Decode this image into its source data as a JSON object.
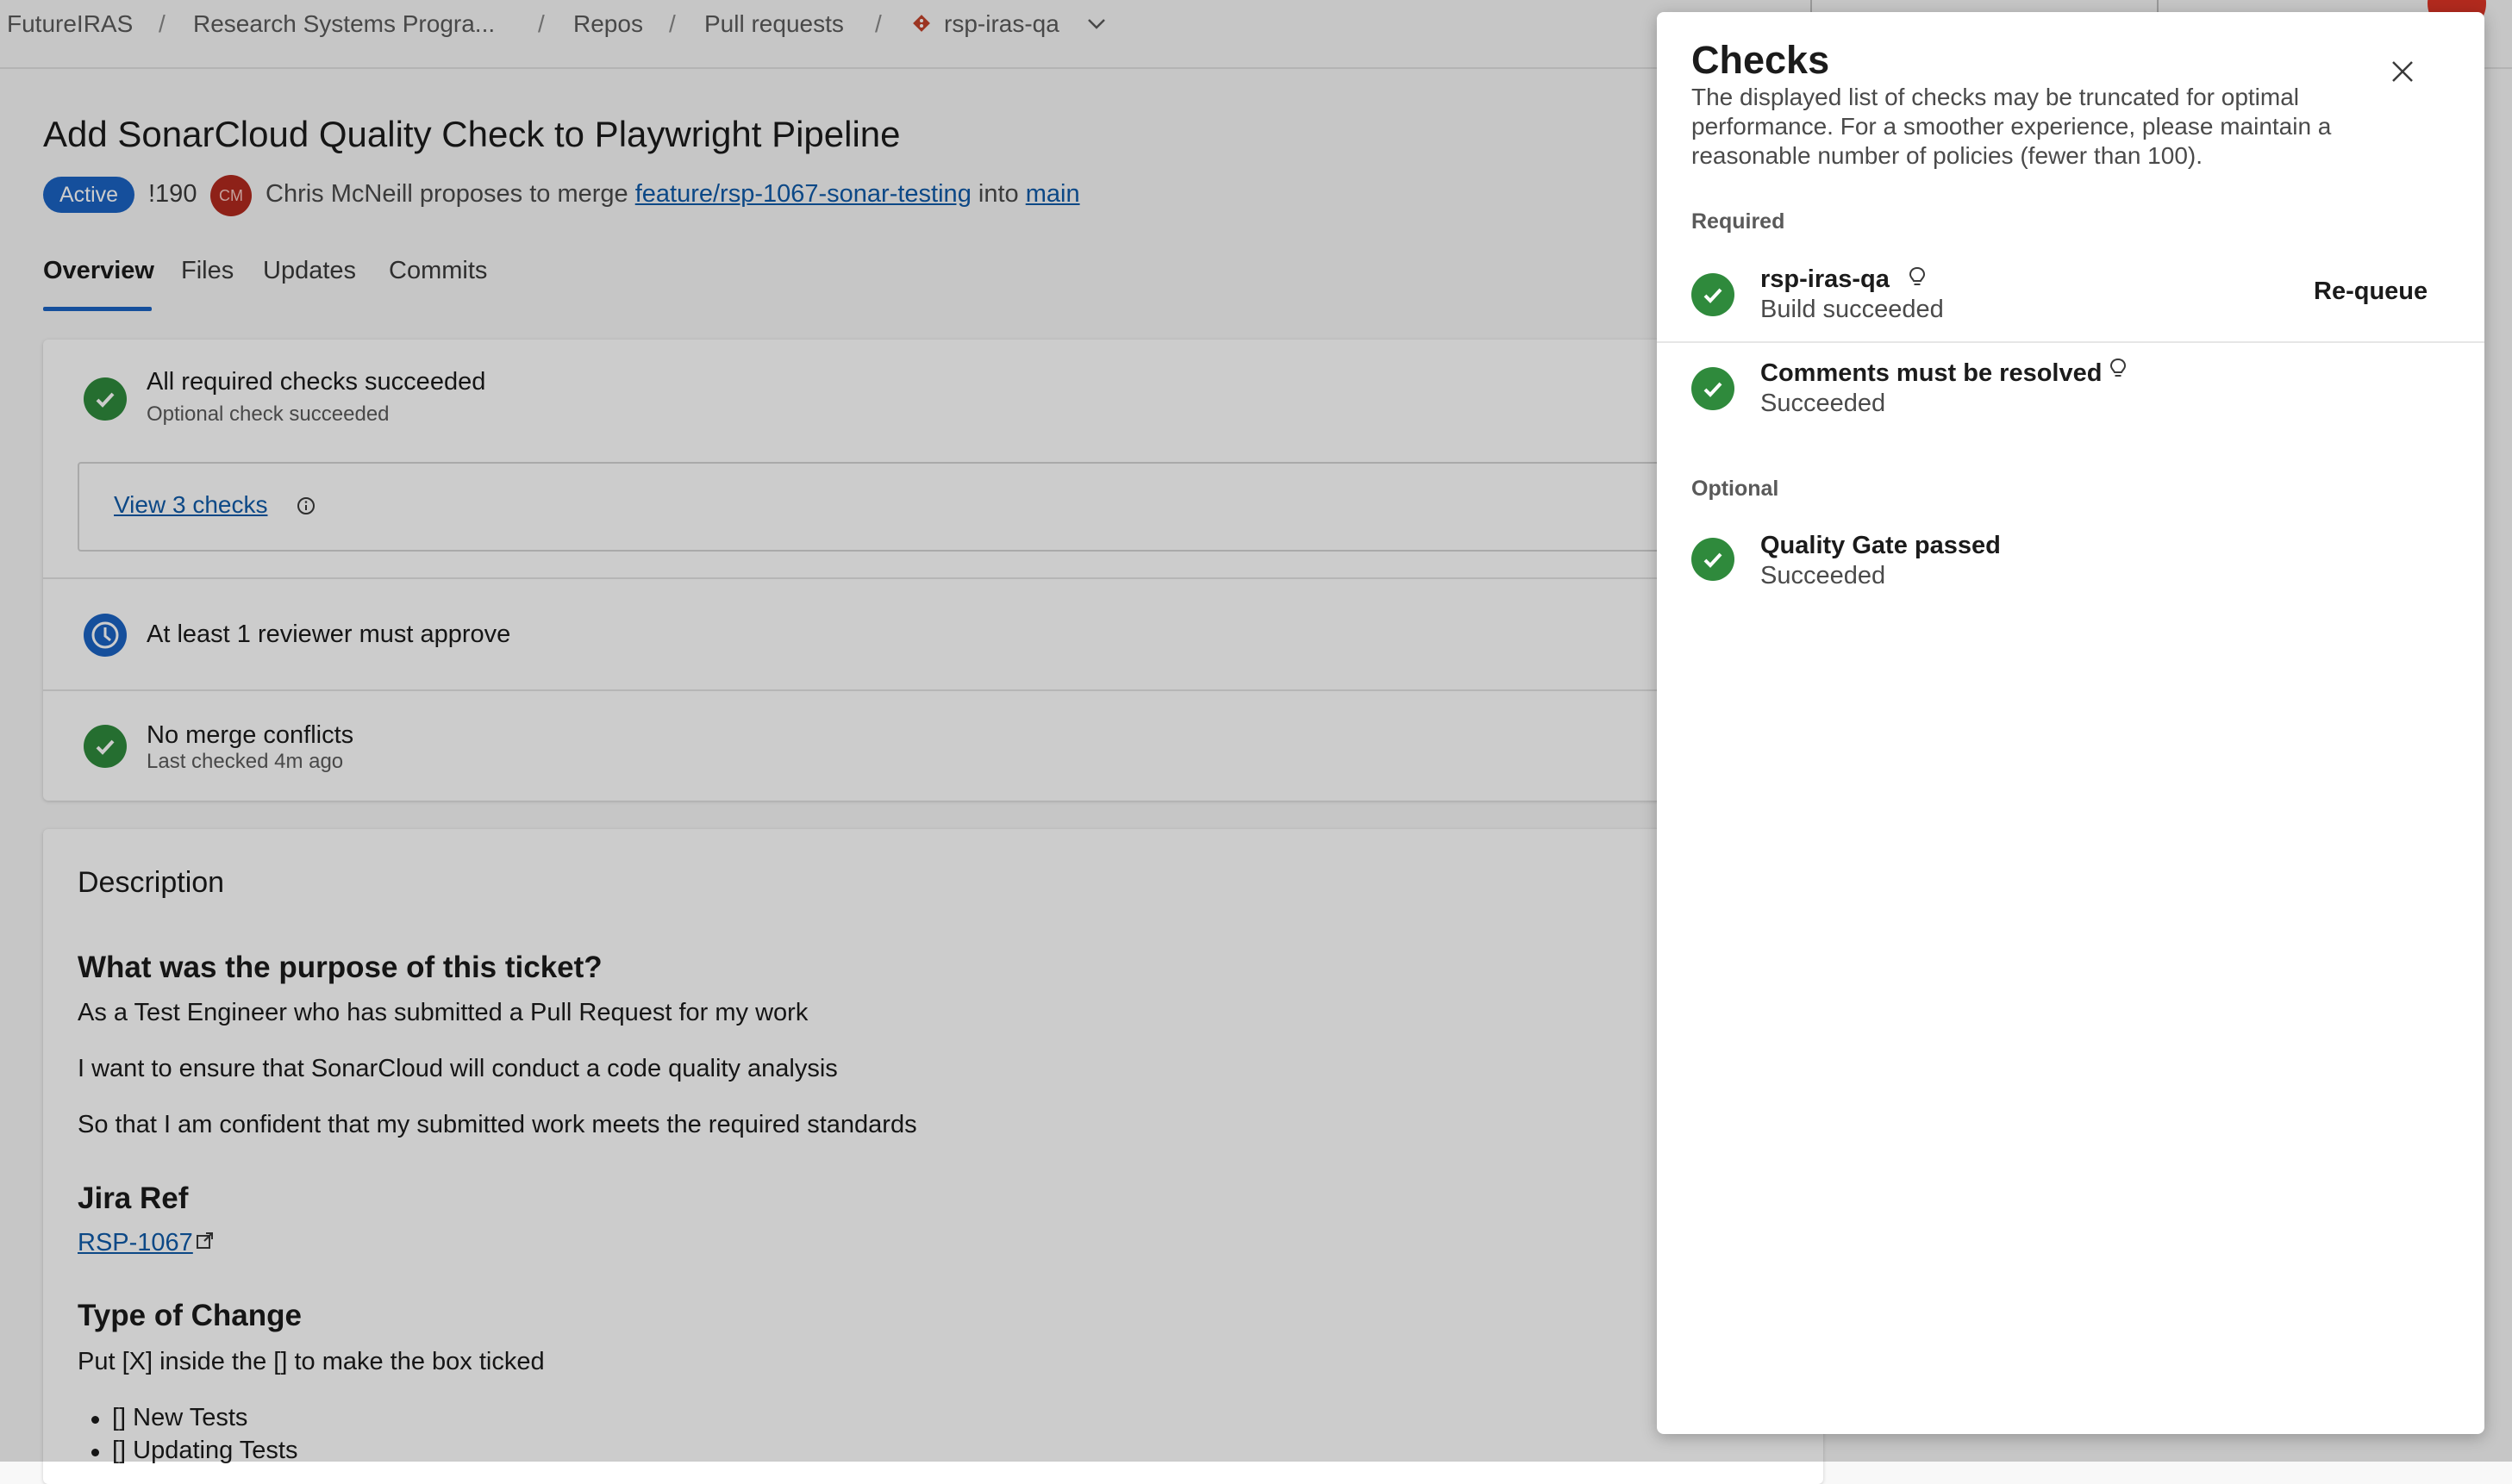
{
  "breadcrumb": {
    "items": [
      "FutureIRAS",
      "Research Systems Progra...",
      "Repos",
      "Pull requests",
      "rsp-iras-qa"
    ],
    "separator": "/"
  },
  "pr": {
    "title": "Add SonarCloud Quality Check to Playwright Pipeline",
    "status_badge": "Active",
    "id": "!190",
    "author_initials": "CM",
    "author_text": "Chris McNeill proposes to merge",
    "source_branch": "feature/rsp-1067-sonar-testing",
    "into_text": "into",
    "target_branch": "main"
  },
  "tabs": [
    "Overview",
    "Files",
    "Updates",
    "Commits"
  ],
  "status": {
    "checks_title": "All required checks succeeded",
    "checks_subtitle": "Optional check succeeded",
    "view_checks_link": "View 3 checks",
    "reviewer_text": "At least 1 reviewer must approve",
    "merge_title": "No merge conflicts",
    "merge_subtitle": "Last checked 4m ago"
  },
  "description": {
    "title": "Description",
    "purpose_heading": "What was the purpose of this ticket?",
    "purpose_lines": [
      "As a Test Engineer who has submitted a Pull Request for my work",
      "I want to ensure that SonarCloud will conduct a code quality analysis",
      "So that I am confident that my submitted work meets the required standards"
    ],
    "jira_heading": "Jira Ref",
    "jira_link": "RSP-1067",
    "change_heading": "Type of Change",
    "change_intro": "Put [X] inside the [] to make the box ticked",
    "change_items": [
      "[] New Tests",
      "[] Updating Tests"
    ]
  },
  "panel": {
    "title": "Checks",
    "note": "The displayed list of checks may be truncated for optimal performance. For a smoother experience, please maintain a reasonable number of policies (fewer than 100).",
    "required_label": "Required",
    "optional_label": "Optional",
    "required_checks": [
      {
        "name": "rsp-iras-qa",
        "status": "Build succeeded",
        "action": "Re-queue"
      },
      {
        "name": "Comments must be resolved",
        "status": "Succeeded"
      }
    ],
    "optional_checks": [
      {
        "name": "Quality Gate passed",
        "status": "Succeeded"
      }
    ]
  },
  "colors": {
    "accent": "#1b63c4",
    "success": "#2f8a3c",
    "avatar": "#b22a1e",
    "link": "#0f5aa8"
  }
}
